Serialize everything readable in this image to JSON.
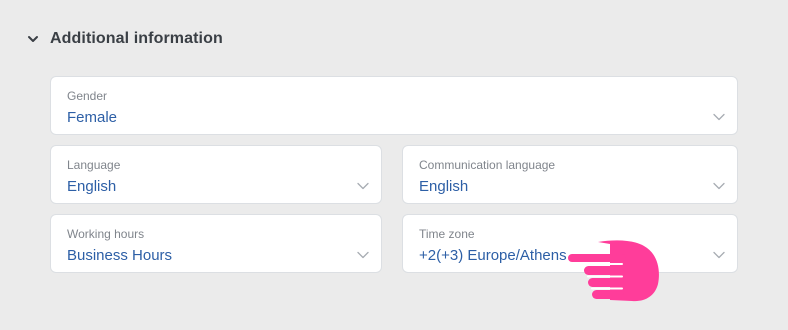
{
  "section": {
    "title": "Additional information",
    "toggle_icon": "chevron-down-icon"
  },
  "fields": {
    "gender": {
      "label": "Gender",
      "value": "Female"
    },
    "language": {
      "label": "Language",
      "value": "English"
    },
    "communication_language": {
      "label": "Communication language",
      "value": "English"
    },
    "working_hours": {
      "label": "Working hours",
      "value": "Business Hours"
    },
    "time_zone": {
      "label": "Time zone",
      "value": "+2(+3) Europe/Athens"
    }
  },
  "overlay": {
    "icon": "hand-pointer-icon",
    "color": "#ff3d9a"
  },
  "colors": {
    "background": "#ebebeb",
    "value_text": "#2d5fa6",
    "label_text": "#80858c",
    "title_text": "#3a3f45"
  }
}
